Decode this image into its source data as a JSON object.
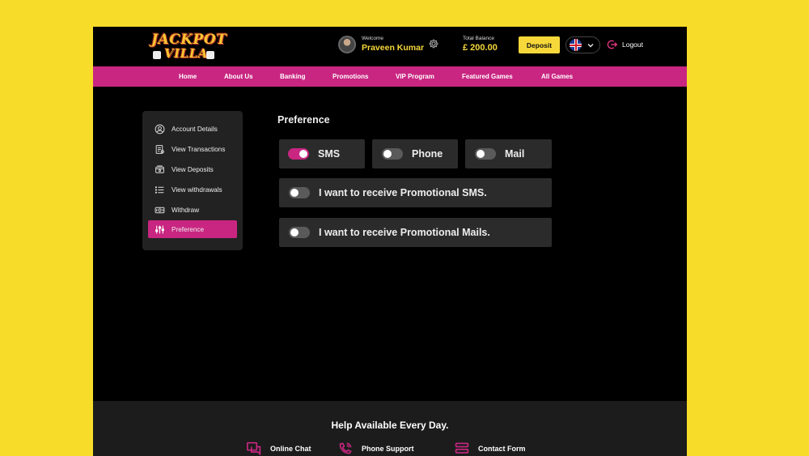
{
  "brand": {
    "logo_line1": "JACKPOT",
    "logo_line2": "VILLA"
  },
  "header": {
    "welcome_label": "Welcome",
    "user_name": "Praveen Kumar",
    "balance_label": "Total Balance",
    "balance_value": "£ 200.00",
    "deposit_label": "Deposit",
    "logout_label": "Logout"
  },
  "nav": [
    "Home",
    "About Us",
    "Banking",
    "Promotions",
    "VIP Program",
    "Featured Games",
    "All Games"
  ],
  "sidebar": {
    "items": [
      {
        "label": "Account Details",
        "icon": "user-circle-icon",
        "active": false
      },
      {
        "label": "View Transactions",
        "icon": "receipt-icon",
        "active": false
      },
      {
        "label": "View Deposits",
        "icon": "wallet-icon",
        "active": false
      },
      {
        "label": "View withdrawals",
        "icon": "list-icon",
        "active": false
      },
      {
        "label": "Withdraw",
        "icon": "cash-icon",
        "active": false
      },
      {
        "label": "Preference",
        "icon": "sliders-icon",
        "active": true
      }
    ]
  },
  "preference": {
    "title": "Preference",
    "channels": [
      {
        "label": "SMS",
        "enabled": true
      },
      {
        "label": "Phone",
        "enabled": false
      },
      {
        "label": "Mail",
        "enabled": false
      }
    ],
    "options": [
      {
        "label": "I want to receive Promotional SMS.",
        "enabled": false
      },
      {
        "label": "I want to receive Promotional Mails.",
        "enabled": false
      }
    ]
  },
  "footer": {
    "title": "Help Available Every Day.",
    "items": [
      {
        "label": "Online Chat",
        "icon": "chat-icon"
      },
      {
        "label": "Phone Support",
        "icon": "phone-icon"
      },
      {
        "label": "Contact Form",
        "icon": "form-icon"
      }
    ]
  },
  "colors": {
    "page_bg": "#f7dc2a",
    "accent": "#c82681",
    "gold": "#f7d83a",
    "panel": "#2b2b2b"
  }
}
